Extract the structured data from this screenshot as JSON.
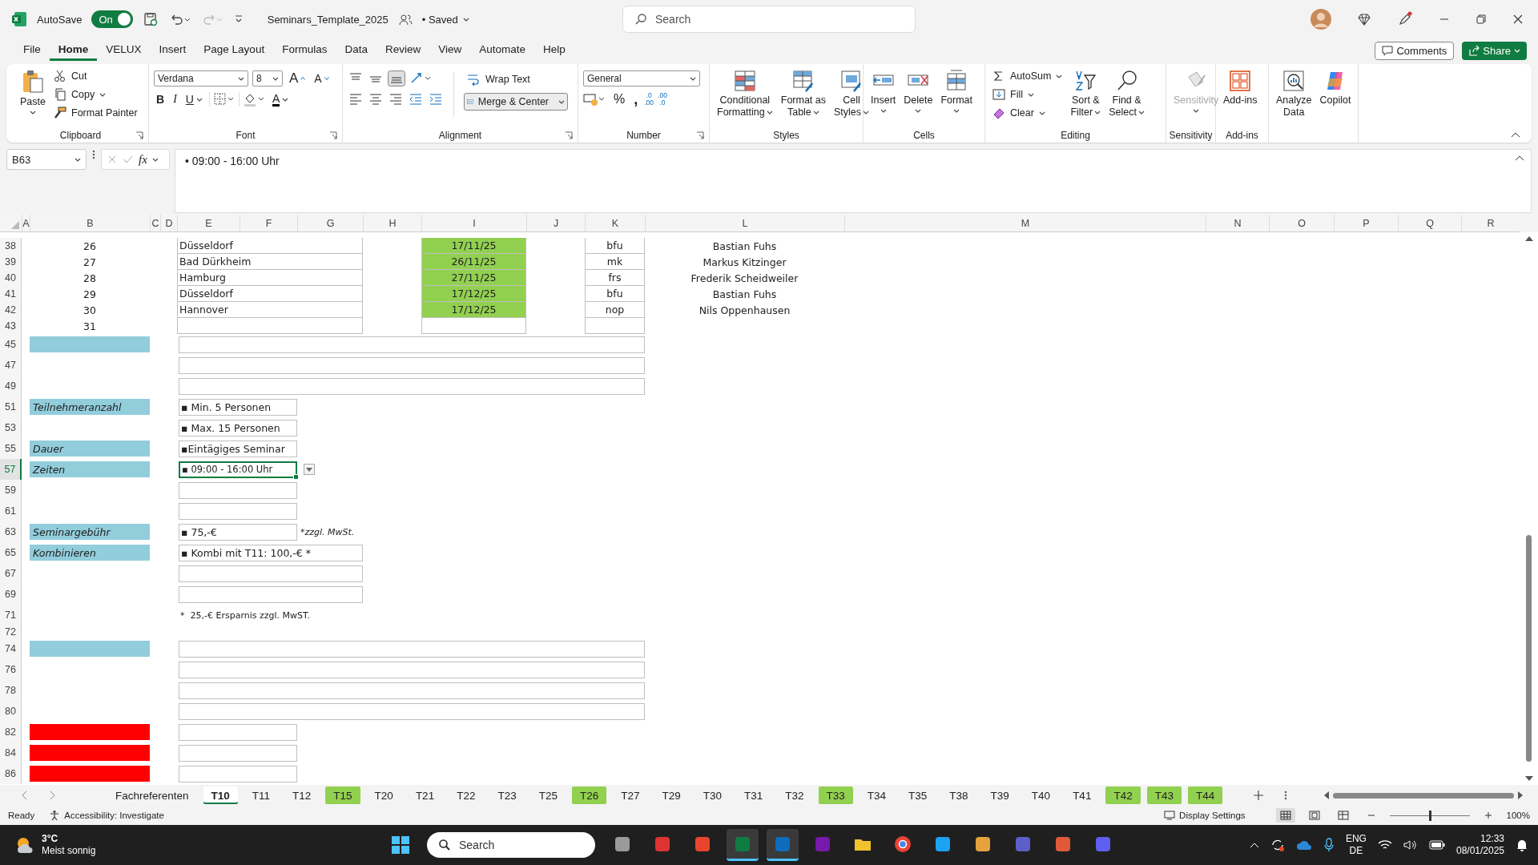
{
  "title_bar": {
    "autosave_label": "AutoSave",
    "autosave": {
      "on": true,
      "label": "On"
    },
    "filename": "Seminars_Template_2025",
    "save_state": "• Saved",
    "search_placeholder": "Search"
  },
  "menu_tabs": [
    {
      "label": "File",
      "selected": false
    },
    {
      "label": "Home",
      "selected": true
    },
    {
      "label": "VELUX",
      "selected": false
    },
    {
      "label": "Insert",
      "selected": false
    },
    {
      "label": "Page Layout",
      "selected": false
    },
    {
      "label": "Formulas",
      "selected": false
    },
    {
      "label": "Data",
      "selected": false
    },
    {
      "label": "Review",
      "selected": false
    },
    {
      "label": "View",
      "selected": false
    },
    {
      "label": "Automate",
      "selected": false
    },
    {
      "label": "Help",
      "selected": false
    }
  ],
  "comments_label": "Comments",
  "share_label": "Share",
  "ribbon": {
    "groups": [
      {
        "title": "Clipboard",
        "commands": [
          {
            "lines": [
              "Paste"
            ],
            "kind": "menu"
          },
          {
            "lines": [
              "Cut"
            ],
            "kind": "button"
          },
          {
            "lines": [
              "Copy"
            ],
            "kind": "menu"
          },
          {
            "lines": [
              "Format Painter"
            ],
            "kind": "button"
          }
        ]
      },
      {
        "title": "Font",
        "font_name": "Verdana",
        "font_size": "8",
        "commands": [
          {
            "lines": [
              "A"
            ]
          },
          {
            "lines": [
              "A"
            ]
          },
          {
            "lines": [
              "B"
            ]
          },
          {
            "lines": [
              "I"
            ]
          },
          {
            "lines": [
              "U"
            ],
            "kind": "menu"
          },
          {
            "lines": [
              "A"
            ],
            "kind": "menu"
          }
        ]
      },
      {
        "title": "Alignment",
        "commands": [
          {
            "lines": [
              "Wrap Text"
            ]
          },
          {
            "lines": [
              "Merge & Center"
            ],
            "kind": "menu"
          }
        ]
      },
      {
        "title": "Number",
        "format": "General",
        "commands": [
          {
            "lines": [
              "%"
            ]
          },
          {
            "lines": [
              ","
            ]
          },
          {
            "lines": [
              ".0",
              ".00"
            ]
          },
          {
            "lines": [
              ".00",
              ".0"
            ]
          }
        ]
      },
      {
        "title": "Styles",
        "commands": [
          {
            "lines": [
              "Conditional",
              "Formatting"
            ],
            "kind": "menu"
          },
          {
            "lines": [
              "Format as",
              "Table"
            ],
            "kind": "menu"
          },
          {
            "lines": [
              "Cell",
              "Styles"
            ],
            "kind": "menu"
          }
        ]
      },
      {
        "title": "Cells",
        "commands": [
          {
            "lines": [
              "Insert"
            ],
            "kind": "menu"
          },
          {
            "lines": [
              "Delete"
            ],
            "kind": "menu"
          },
          {
            "lines": [
              "Format"
            ],
            "kind": "menu"
          }
        ]
      },
      {
        "title": "Editing",
        "commands": [
          {
            "lines": [
              "AutoSum"
            ],
            "kind": "menu"
          },
          {
            "lines": [
              "Fill"
            ],
            "kind": "menu"
          },
          {
            "lines": [
              "Clear"
            ],
            "kind": "menu"
          },
          {
            "lines": [
              "Sort &",
              "Filter"
            ],
            "kind": "menu"
          },
          {
            "lines": [
              "Find &",
              "Select"
            ],
            "kind": "menu"
          }
        ]
      },
      {
        "title": "Sensitivity",
        "commands": [
          {
            "lines": [
              "Sensitivity"
            ],
            "kind": "menu",
            "disabled": true
          }
        ]
      },
      {
        "title": "Add-ins",
        "commands": [
          {
            "lines": [
              "Add-ins"
            ],
            "kind": "button"
          }
        ]
      },
      {
        "commands": [
          {
            "lines": [
              "Analyze",
              "Data"
            ],
            "kind": "button"
          },
          {
            "lines": [
              "Copilot"
            ],
            "kind": "button"
          }
        ]
      }
    ]
  },
  "formula_bar": {
    "name_box": "B63",
    "fx": "fx",
    "formula": "• 09:00 - 16:00 Uhr"
  },
  "grid": {
    "columns": [
      "A",
      "B",
      "C",
      "D",
      "E",
      "F",
      "G",
      "H",
      "I",
      "J",
      "K",
      "L",
      "M",
      "N",
      "O",
      "P",
      "Q",
      "R"
    ],
    "rows": [
      {
        "kind": "seminar",
        "number": "38",
        "index": "26",
        "place": "Düsseldorf",
        "date": {
          "text": "17/11/25",
          "color": "#92d050"
        },
        "code": "bfu",
        "name": "Bastian Fuhs",
        "active": false
      },
      {
        "kind": "seminar",
        "number": "39",
        "index": "27",
        "place": "Bad Dürkheim",
        "date": {
          "text": "26/11/25",
          "color": "#92d050"
        },
        "code": "mk",
        "name": "Markus Kitzinger",
        "active": false
      },
      {
        "kind": "seminar",
        "number": "40",
        "index": "28",
        "place": "Hamburg",
        "date": {
          "text": "27/11/25",
          "color": "#92d050"
        },
        "code": "frs",
        "name": "Frederik Scheidweiler",
        "active": false
      },
      {
        "kind": "seminar",
        "number": "41",
        "index": "29",
        "place": "Düsseldorf",
        "date": {
          "text": "17/12/25",
          "color": "#92d050"
        },
        "code": "bfu",
        "name": "Bastian Fuhs",
        "active": false
      },
      {
        "kind": "seminar",
        "number": "42",
        "index": "30",
        "place": "Hannover",
        "date": {
          "text": "17/12/25",
          "color": "#92d050"
        },
        "code": "nop",
        "name": "Nils Oppenhausen",
        "active": false
      },
      {
        "kind": "seminar",
        "number": "43",
        "index": "31",
        "active": false
      },
      {
        "kind": "form",
        "number": "45",
        "label": {
          "color": "#92cddc"
        },
        "field": {
          "kind": "wide"
        },
        "active": false
      },
      {
        "kind": "form",
        "number": "47",
        "field": {
          "kind": "wide"
        },
        "active": false
      },
      {
        "kind": "form",
        "number": "49",
        "field": {
          "kind": "wide"
        },
        "active": false
      },
      {
        "kind": "form",
        "number": "51",
        "label": {
          "text": "Teilnehmeranzahl",
          "color": "#92cddc"
        },
        "field": {
          "kind": "short",
          "value": "▪ Min. 5 Personen"
        },
        "active": false
      },
      {
        "kind": "form",
        "number": "53",
        "field": {
          "kind": "short",
          "value": "▪ Max. 15 Personen"
        },
        "active": false
      },
      {
        "kind": "form",
        "number": "55",
        "label": {
          "text": "Dauer",
          "color": "#92cddc"
        },
        "field": {
          "kind": "short",
          "value": "▪Eintägiges Seminar"
        },
        "active": false
      },
      {
        "kind": "form",
        "number": "57",
        "label": {
          "text": "Zeiten",
          "color": "#92cddc"
        },
        "field": {
          "kind": "short",
          "value": "▪ 09:00 - 16:00 Uhr"
        },
        "active": true
      },
      {
        "kind": "form",
        "number": "59",
        "field": {
          "kind": "short"
        },
        "active": false
      },
      {
        "kind": "form",
        "number": "61",
        "field": {
          "kind": "short"
        },
        "active": false
      },
      {
        "kind": "form",
        "number": "63",
        "label": {
          "text": "Seminargebühr",
          "color": "#92cddc"
        },
        "field": {
          "kind": "short",
          "value": "▪ 75,-€"
        },
        "note": "*zzgl. MwSt.",
        "active": false
      },
      {
        "kind": "form",
        "number": "65",
        "label": {
          "text": "Kombinieren",
          "color": "#92cddc"
        },
        "field": {
          "kind": "medium",
          "value": "▪ Kombi mit T11: 100,-€ *"
        },
        "active": false
      },
      {
        "kind": "form",
        "number": "67",
        "field": {
          "kind": "medium"
        },
        "active": false
      },
      {
        "kind": "form",
        "number": "69",
        "field": {
          "kind": "medium"
        },
        "active": false
      },
      {
        "kind": "note",
        "number": "71",
        "text": "*  25,-€ Ersparnis zzgl. MwST.",
        "active": false
      },
      {
        "kind": "spacer",
        "number": "72",
        "active": false
      },
      {
        "kind": "form",
        "number": "74",
        "label": {
          "color": "#92cddc"
        },
        "field": {
          "kind": "wide"
        },
        "active": false
      },
      {
        "kind": "form",
        "number": "76",
        "field": {
          "kind": "wide"
        },
        "active": false
      },
      {
        "kind": "form",
        "number": "78",
        "field": {
          "kind": "wide"
        },
        "active": false
      },
      {
        "kind": "form",
        "number": "80",
        "field": {
          "kind": "wide"
        },
        "active": false
      },
      {
        "kind": "form",
        "number": "82",
        "label": {
          "color": "#ff0000"
        },
        "field": {
          "kind": "short"
        },
        "active": false
      },
      {
        "kind": "form",
        "number": "84",
        "label": {
          "color": "#ff0000"
        },
        "field": {
          "kind": "short"
        },
        "active": false
      },
      {
        "kind": "form",
        "number": "86",
        "label": {
          "color": "#ff0000"
        },
        "field": {
          "kind": "short"
        },
        "active": false
      }
    ]
  },
  "sheet_tabs": [
    {
      "label": "Fachreferenten",
      "selected": false
    },
    {
      "label": "T10",
      "selected": true
    },
    {
      "label": "T11",
      "selected": false
    },
    {
      "label": "T12",
      "selected": false
    },
    {
      "label": "T15",
      "selected": false,
      "color": "#92d050"
    },
    {
      "label": "T20",
      "selected": false
    },
    {
      "label": "T21",
      "selected": false
    },
    {
      "label": "T22",
      "selected": false
    },
    {
      "label": "T23",
      "selected": false
    },
    {
      "label": "T25",
      "selected": false
    },
    {
      "label": "T26",
      "selected": false,
      "color": "#92d050"
    },
    {
      "label": "T27",
      "selected": false
    },
    {
      "label": "T29",
      "selected": false
    },
    {
      "label": "T30",
      "selected": false
    },
    {
      "label": "T31",
      "selected": false
    },
    {
      "label": "T32",
      "selected": false
    },
    {
      "label": "T33",
      "selected": false,
      "color": "#92d050"
    },
    {
      "label": "T34",
      "selected": false
    },
    {
      "label": "T35",
      "selected": false
    },
    {
      "label": "T38",
      "selected": false
    },
    {
      "label": "T39",
      "selected": false
    },
    {
      "label": "T40",
      "selected": false
    },
    {
      "label": "T41",
      "selected": false
    },
    {
      "label": "T42",
      "selected": false,
      "color": "#92d050"
    },
    {
      "label": "T43",
      "selected": false,
      "color": "#92d050"
    },
    {
      "label": "T44",
      "selected": false,
      "color": "#92d050"
    }
  ],
  "status_bar": {
    "mode": "Ready",
    "accessibility": "Accessibility: Investigate",
    "display_settings": "Display Settings",
    "views": [
      {
        "selected": true
      },
      {
        "selected": false
      },
      {
        "selected": false
      }
    ],
    "zoom": {
      "level": 0.5,
      "reading": "100%"
    }
  },
  "taskbar": {
    "temperature": "3°C",
    "weather": "Meist sonnig",
    "search_placeholder": "Search",
    "apps": [
      {
        "active": false
      },
      {
        "active": false
      },
      {
        "active": false
      },
      {
        "active": true
      },
      {
        "active": true
      },
      {
        "active": false
      },
      {
        "active": false
      },
      {
        "active": false
      },
      {
        "active": false
      },
      {
        "active": false
      },
      {
        "active": false
      },
      {
        "active": false
      },
      {
        "active": false
      }
    ],
    "language": "ENG",
    "layout": "DE",
    "time": "12:33",
    "date": "08/01/2025"
  }
}
